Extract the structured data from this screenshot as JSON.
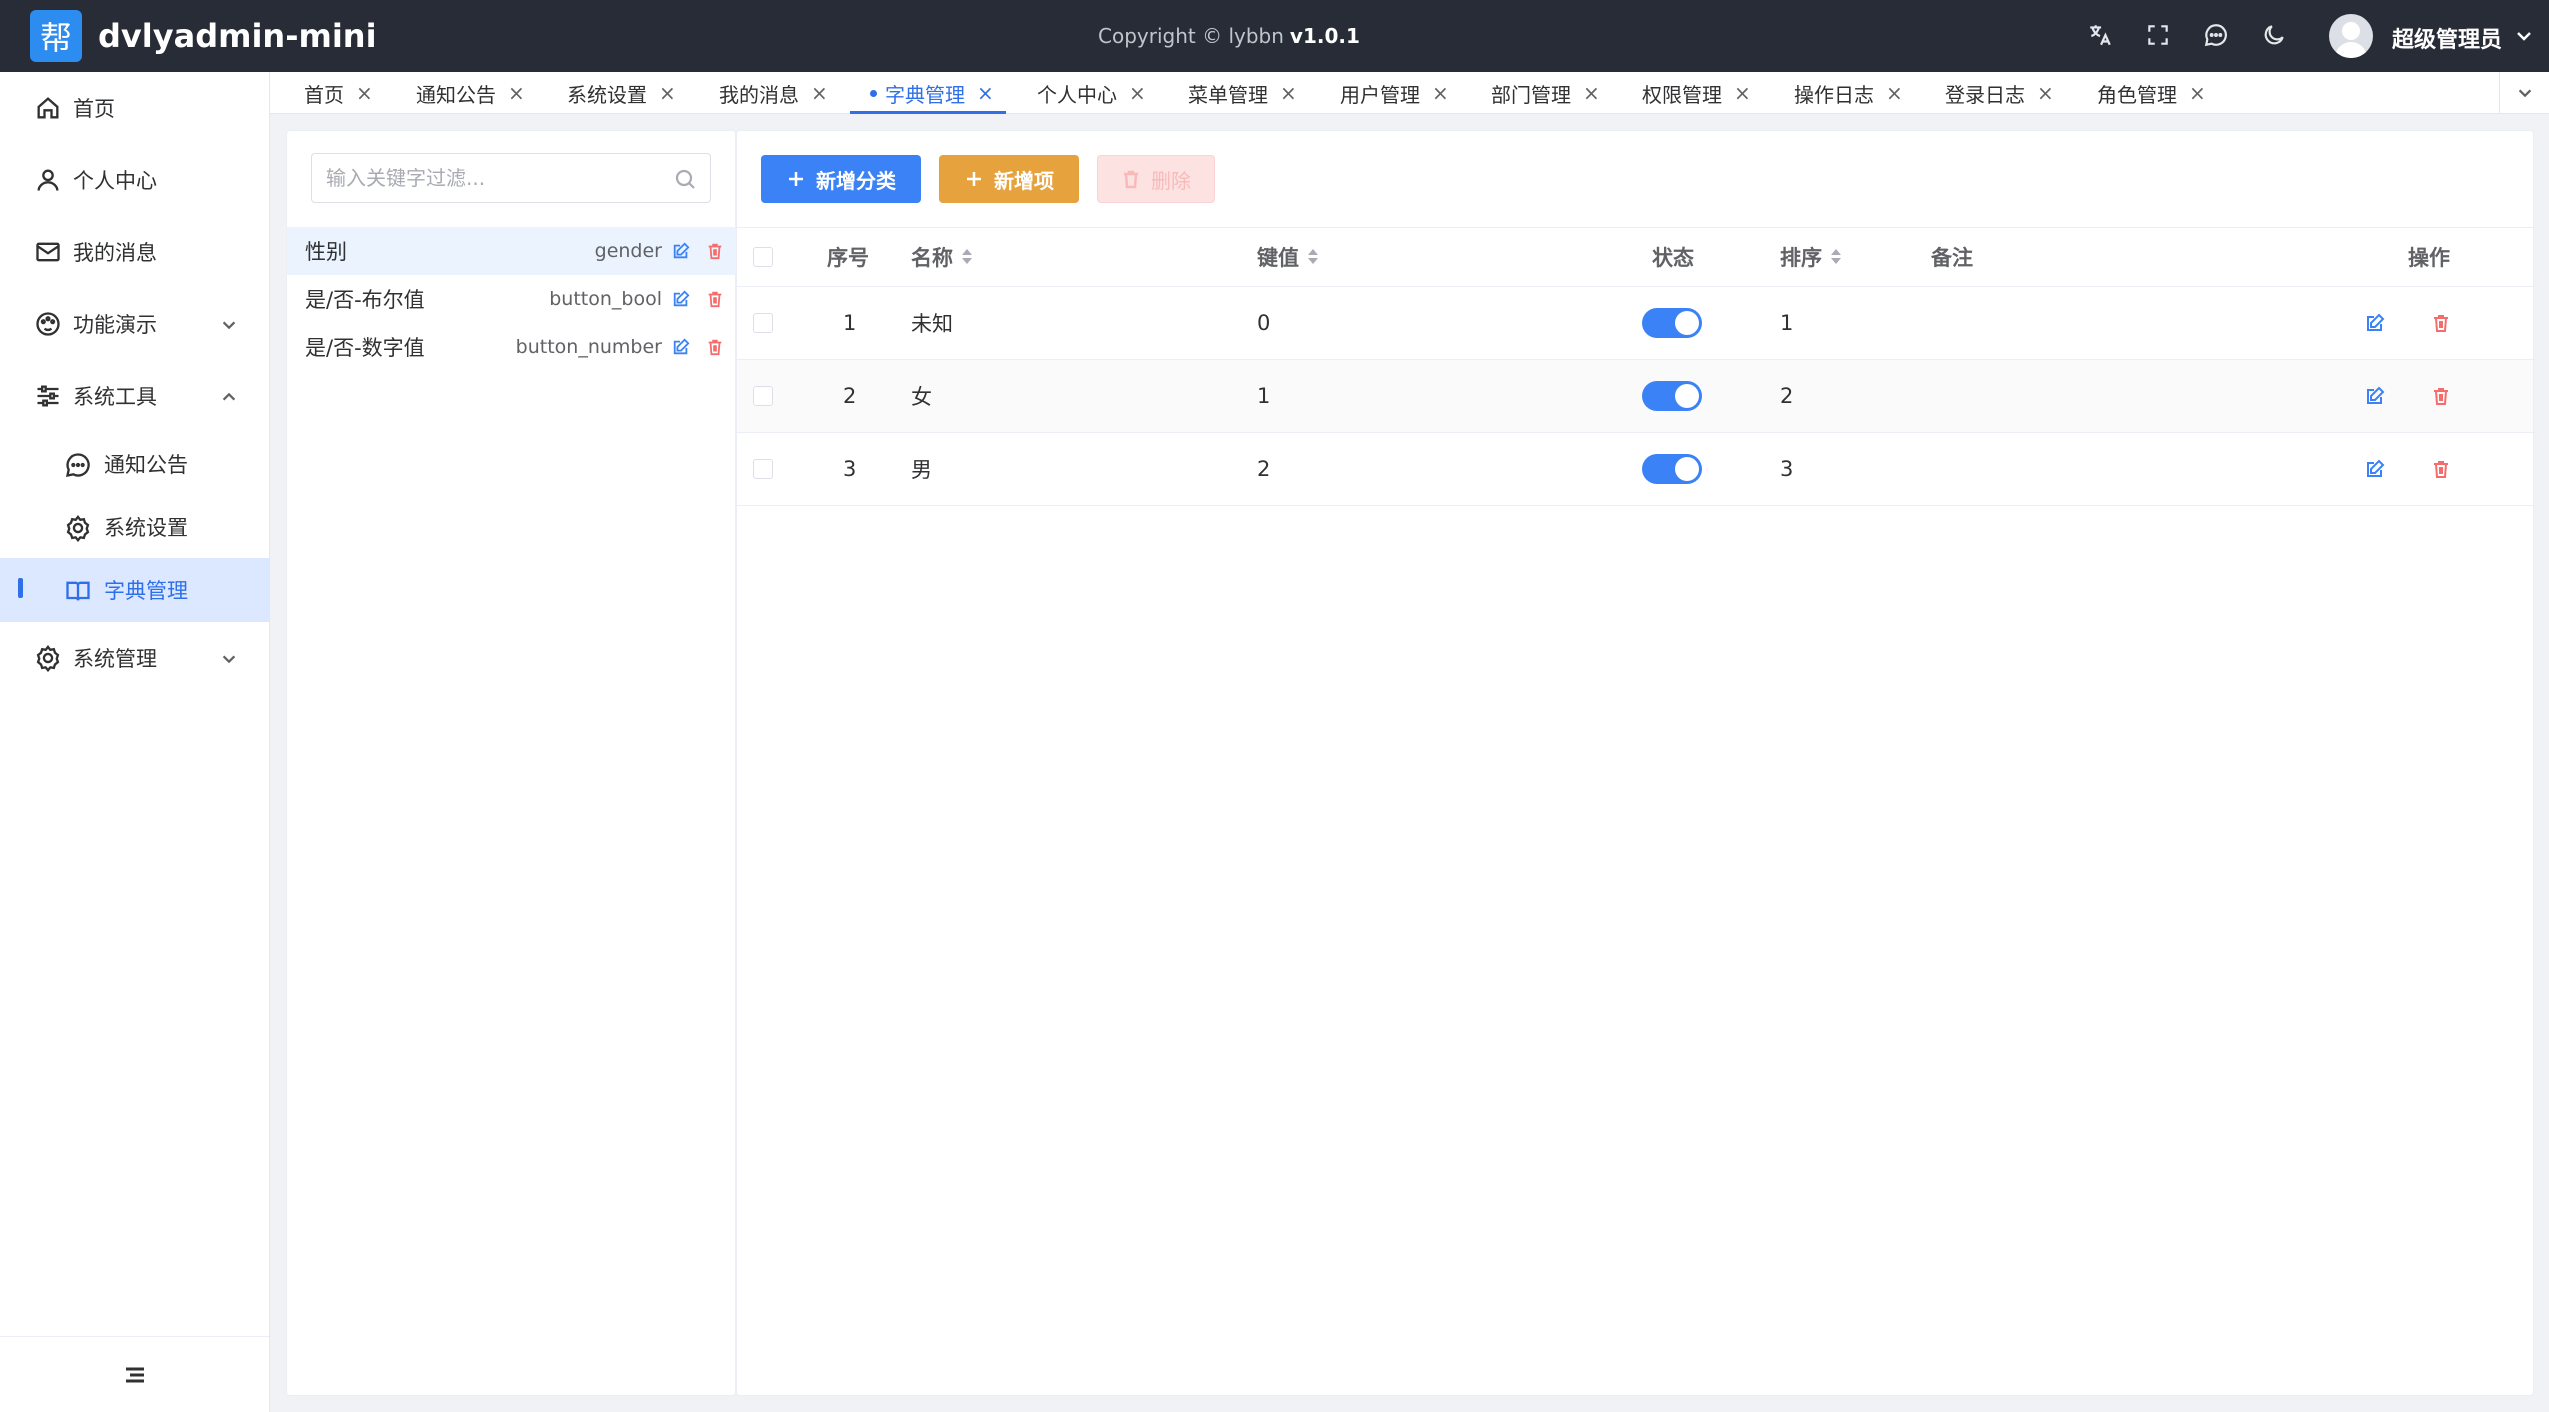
{
  "header": {
    "logo_char": "帮",
    "app_title": "dvlyadmin-mini",
    "copyright": "Copyright © lybbn",
    "version": "v1.0.1",
    "username": "超级管理员"
  },
  "sidebar": {
    "items": [
      {
        "label": "首页",
        "icon": "home-icon"
      },
      {
        "label": "个人中心",
        "icon": "user-icon"
      },
      {
        "label": "我的消息",
        "icon": "mail-icon"
      },
      {
        "label": "功能演示",
        "icon": "palette-icon"
      },
      {
        "label": "系统工具",
        "icon": "sliders-icon"
      },
      {
        "label": "通知公告",
        "icon": "chat-icon"
      },
      {
        "label": "系统设置",
        "icon": "gear-icon"
      },
      {
        "label": "字典管理",
        "icon": "book-icon"
      },
      {
        "label": "系统管理",
        "icon": "gear-icon"
      }
    ]
  },
  "tabs": [
    {
      "label": "首页"
    },
    {
      "label": "通知公告"
    },
    {
      "label": "系统设置"
    },
    {
      "label": "我的消息"
    },
    {
      "label": "字典管理"
    },
    {
      "label": "个人中心"
    },
    {
      "label": "菜单管理"
    },
    {
      "label": "用户管理"
    },
    {
      "label": "部门管理"
    },
    {
      "label": "权限管理"
    },
    {
      "label": "操作日志"
    },
    {
      "label": "登录日志"
    },
    {
      "label": "角色管理"
    }
  ],
  "tab_close_glyph": "×",
  "dict_panel": {
    "search_placeholder": "输入关键字过滤...",
    "items": [
      {
        "name": "性别",
        "code": "gender"
      },
      {
        "name": "是/否-布尔值",
        "code": "button_bool"
      },
      {
        "name": "是/否-数字值",
        "code": "button_number"
      }
    ]
  },
  "toolbar": {
    "add_category_label": "新增分类",
    "add_item_label": "新增项",
    "delete_label": "删除"
  },
  "table": {
    "headers": {
      "index": "序号",
      "name": "名称",
      "value": "键值",
      "status": "状态",
      "sort": "排序",
      "remark": "备注",
      "actions": "操作"
    },
    "rows": [
      {
        "index": "1",
        "name": "未知",
        "value": "0",
        "status": true,
        "sort": "1",
        "remark": ""
      },
      {
        "index": "2",
        "name": "女",
        "value": "1",
        "status": true,
        "sort": "2",
        "remark": ""
      },
      {
        "index": "3",
        "name": "男",
        "value": "2",
        "status": true,
        "sort": "3",
        "remark": ""
      }
    ]
  },
  "colors": {
    "header_bg": "#272c36",
    "primary": "#3b82f6",
    "warning": "#e6a23c",
    "danger": "#f56c6c",
    "active_menu_bg": "#dbe8ff"
  }
}
